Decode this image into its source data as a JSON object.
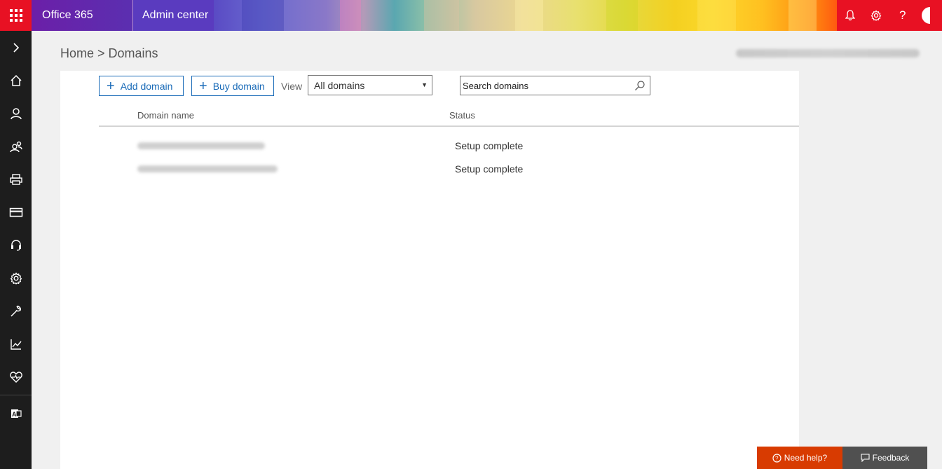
{
  "header": {
    "brand": "Office 365",
    "app_name": "Admin center"
  },
  "top_icons": [
    "bell-icon",
    "gear-icon",
    "help-icon"
  ],
  "breadcrumb": "Home > Domains",
  "toolbar": {
    "add_label": "Add domain",
    "buy_label": "Buy domain",
    "view_label": "View",
    "view_selected": "All domains",
    "search_placeholder": "Search domains"
  },
  "table": {
    "columns": [
      "Domain name",
      "Status"
    ],
    "rows": [
      {
        "status": "Setup complete"
      },
      {
        "status": "Setup complete"
      }
    ]
  },
  "footer": {
    "help_label": "Need help?",
    "feedback_label": "Feedback"
  },
  "colors": {
    "accent": "#1a6bb8",
    "header_red": "#e81123",
    "nav_bg": "#1d1d1d",
    "help_bg": "#d83b01"
  }
}
